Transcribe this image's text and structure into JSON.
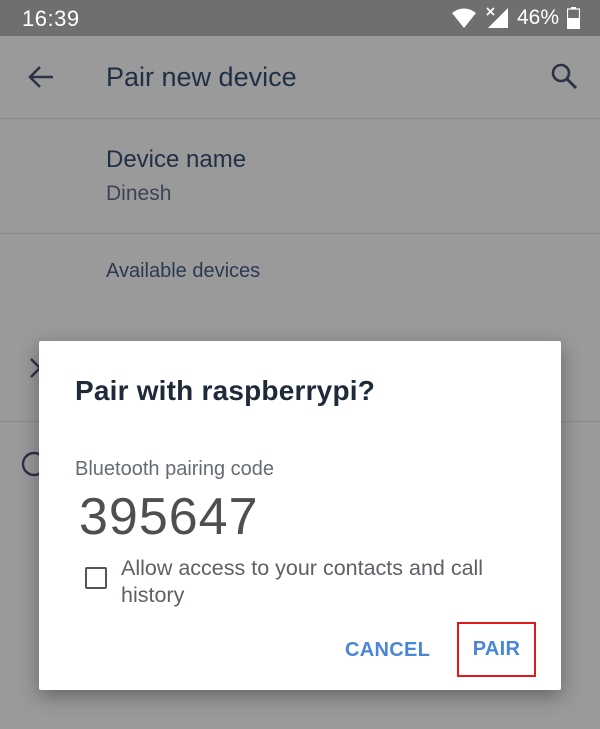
{
  "status_bar": {
    "time": "16:39",
    "battery_percent": "46%",
    "icons": [
      "wifi-icon",
      "no-signal-icon",
      "battery-icon"
    ]
  },
  "app_bar": {
    "title": "Pair new device",
    "icons": [
      "back-arrow-icon",
      "search-icon"
    ]
  },
  "device_name": {
    "title": "Device name",
    "value": "Dinesh"
  },
  "available_devices": {
    "label": "Available devices"
  },
  "dialog": {
    "title": "Pair with raspberrypi?",
    "code_label": "Bluetooth pairing code",
    "code": "395647",
    "checkbox_label": "Allow access to your contacts and call history",
    "checkbox_checked": false,
    "cancel_label": "CANCEL",
    "pair_label": "PAIR",
    "accent_color": "#4a86d8",
    "highlight_color": "#e0191b"
  }
}
